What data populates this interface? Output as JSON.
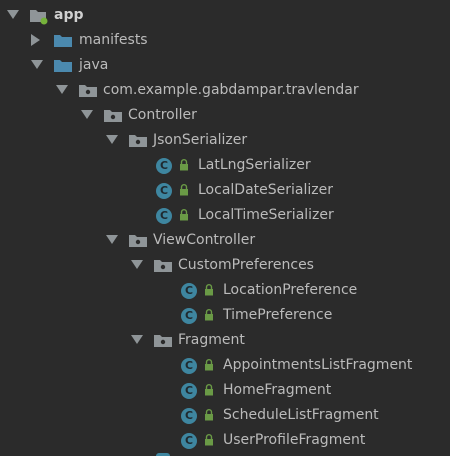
{
  "project_tree": {
    "colors": {
      "background": "#2b2b2b",
      "text": "#bbbbbb",
      "folder_blue": "#4b89ae",
      "folder_gray": "#8f9598",
      "class_badge": "#3e86a0",
      "lock_green": "#6a9a46",
      "module_dot": "#76b33b"
    },
    "items": [
      {
        "label": "app",
        "icon": "module-folder-icon",
        "expanded": true
      },
      {
        "label": "manifests",
        "icon": "folder-icon",
        "expanded": false
      },
      {
        "label": "java",
        "icon": "folder-icon",
        "expanded": true
      },
      {
        "label": "com.example.gabdampar.travlendar",
        "icon": "package-icon",
        "expanded": true
      },
      {
        "label": "Controller",
        "icon": "package-icon",
        "expanded": true
      },
      {
        "label": "JsonSerializer",
        "icon": "package-icon",
        "expanded": true
      },
      {
        "label": "LatLngSerializer",
        "icon": "class-icon",
        "badge": "C"
      },
      {
        "label": "LocalDateSerializer",
        "icon": "class-icon",
        "badge": "C"
      },
      {
        "label": "LocalTimeSerializer",
        "icon": "class-icon",
        "badge": "C"
      },
      {
        "label": "ViewController",
        "icon": "package-icon",
        "expanded": true
      },
      {
        "label": "CustomPreferences",
        "icon": "package-icon",
        "expanded": true
      },
      {
        "label": "LocationPreference",
        "icon": "class-icon",
        "badge": "C"
      },
      {
        "label": "TimePreference",
        "icon": "class-icon",
        "badge": "C"
      },
      {
        "label": "Fragment",
        "icon": "package-icon",
        "expanded": true
      },
      {
        "label": "AppointmentsListFragment",
        "icon": "class-icon",
        "badge": "C"
      },
      {
        "label": "HomeFragment",
        "icon": "class-icon",
        "badge": "C"
      },
      {
        "label": "ScheduleListFragment",
        "icon": "class-icon",
        "badge": "C"
      },
      {
        "label": "UserProfileFragment",
        "icon": "class-icon",
        "badge": "C"
      }
    ]
  }
}
